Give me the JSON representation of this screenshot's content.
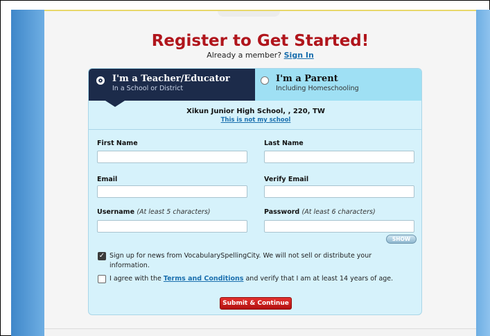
{
  "header": {
    "title": "Register to Get Started!",
    "member_prompt": "Already a member?",
    "sign_in_link": "Sign In"
  },
  "tabs": [
    {
      "title": "I'm a Teacher/Educator",
      "subtitle": "In a School or District",
      "selected": true
    },
    {
      "title": "I'm a Parent",
      "subtitle": "Including Homeschooling",
      "selected": false
    }
  ],
  "school": {
    "name": "Xikun Junior High School, , 220, TW",
    "change_link": "This is not my school"
  },
  "fields": {
    "first_name": {
      "label": "First Name",
      "value": ""
    },
    "last_name": {
      "label": "Last Name",
      "value": ""
    },
    "email": {
      "label": "Email",
      "value": ""
    },
    "verify_email": {
      "label": "Verify Email",
      "value": ""
    },
    "username": {
      "label": "Username",
      "hint": "(At least 5 characters)",
      "value": ""
    },
    "password": {
      "label": "Password",
      "hint": "(At least 6 characters)",
      "value": ""
    }
  },
  "show_button": "SHOW",
  "newsletter": {
    "checked": true,
    "text": "Sign up for news from VocabularySpellingCity. We will not sell or distribute your information."
  },
  "terms": {
    "checked": false,
    "prefix": "I agree with the",
    "link": "Terms and Conditions",
    "suffix": "and verify that I am at least 14 years of age."
  },
  "submit_label": "Submit & Continue",
  "colors": {
    "title_red": "#b0151c",
    "link_blue": "#1a6fae",
    "tab_selected": "#1c2b4a",
    "tab_unselected": "#9fe0f4",
    "form_bg": "#d6f2fb",
    "submit_red": "#c8201f"
  }
}
